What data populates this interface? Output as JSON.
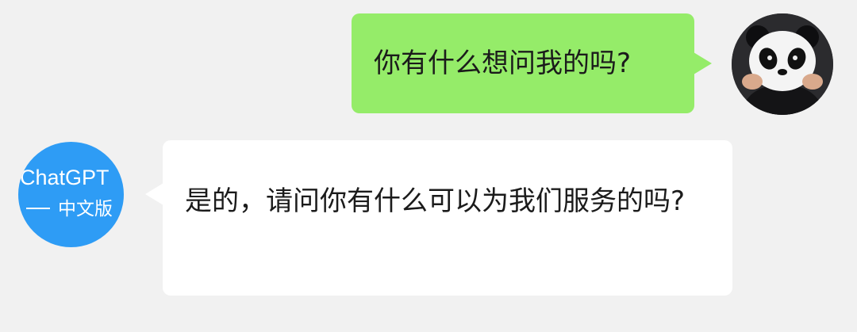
{
  "conversation": {
    "outgoing": {
      "text": "你有什么想问我的吗?",
      "bubble_color": "#95ec69",
      "avatar_icon": "panda-head-avatar"
    },
    "incoming": {
      "text": "是的，请问你有什么可以为我们服务的吗?",
      "bubble_color": "#ffffff",
      "avatar": {
        "brand": "ChatGPT",
        "edition": "中文版",
        "background": "#2e9cf5"
      }
    }
  },
  "background_color": "#f1f1f1"
}
